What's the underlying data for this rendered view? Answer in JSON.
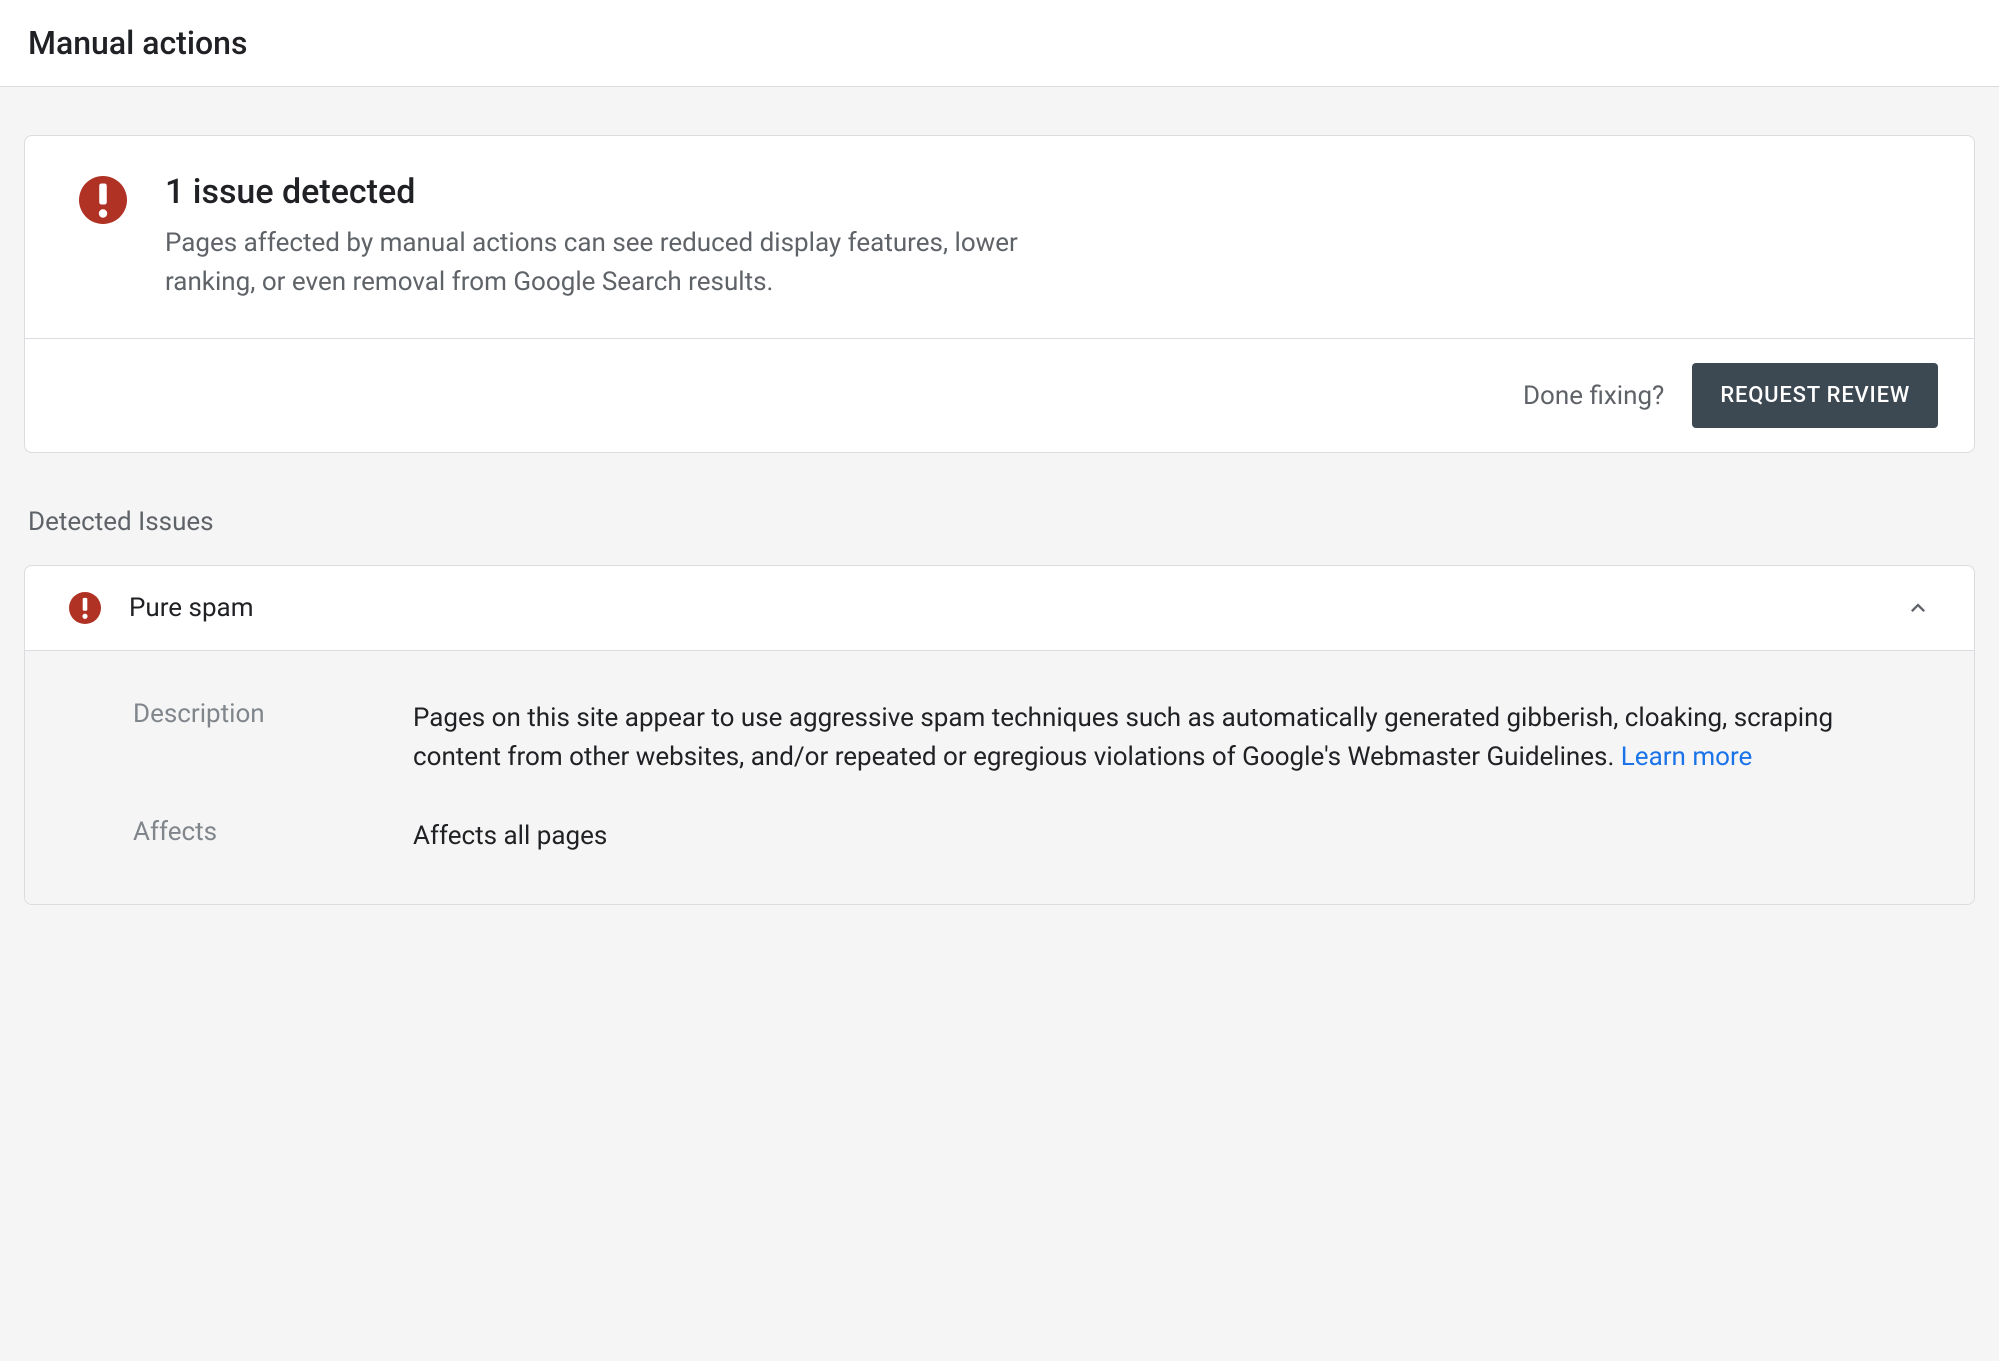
{
  "header": {
    "title": "Manual actions"
  },
  "alert": {
    "title": "1 issue detected",
    "description": "Pages affected by manual actions can see reduced display features, lower ranking, or even removal from Google Search results."
  },
  "actions": {
    "done_fixing_label": "Done fixing?",
    "request_review_label": "REQUEST REVIEW"
  },
  "section": {
    "title": "Detected Issues"
  },
  "issue": {
    "name": "Pure spam",
    "description_label": "Description",
    "description_text": "Pages on this site appear to use aggressive spam techniques such as automatically generated gibberish, cloaking, scraping content from other websites, and/or repeated or egregious violations of Google's Webmaster Guidelines. ",
    "learn_more_label": "Learn more",
    "affects_label": "Affects",
    "affects_value": "Affects all pages"
  },
  "colors": {
    "alert_red": "#b03224",
    "button_bg": "#3c4852",
    "link_blue": "#1a73e8"
  }
}
